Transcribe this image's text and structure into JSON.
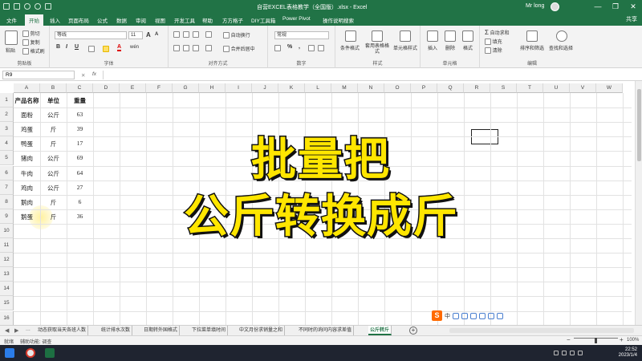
{
  "window": {
    "title": "自营EXCEL表格教学（全国版）.xlsx - Excel",
    "user": "Mr long",
    "minimize_label": "—",
    "restore_label": "❐",
    "close_label": "✕"
  },
  "tabs": [
    {
      "label": "文件"
    },
    {
      "label": "开始"
    },
    {
      "label": "插入"
    },
    {
      "label": "页面布局"
    },
    {
      "label": "公式"
    },
    {
      "label": "数据"
    },
    {
      "label": "审阅"
    },
    {
      "label": "视图"
    },
    {
      "label": "开发工具"
    },
    {
      "label": "帮助"
    },
    {
      "label": "方方格子"
    },
    {
      "label": "DIY工具箱"
    },
    {
      "label": "Power Pivot"
    },
    {
      "label": "操作说明搜索"
    }
  ],
  "share_label": "共享",
  "ribbon": {
    "clipboard": {
      "paste": "粘贴",
      "cut": "剪切",
      "copy": "复制",
      "format_painter": "格式刷",
      "group": "剪贴板"
    },
    "font": {
      "name": "等线",
      "size": "11",
      "bold": "B",
      "italic": "I",
      "underline": "U",
      "grow": "A",
      "shrink": "A",
      "font_color": "A",
      "wen": "wén",
      "group": "字体"
    },
    "alignment": {
      "wrap": "自动换行",
      "merge": "合并后居中",
      "group": "对齐方式"
    },
    "number": {
      "format": "常规",
      "currency": "%",
      "comma": ",",
      "group": "数字"
    },
    "styles": {
      "conditional": "条件格式",
      "table": "套用表格格式",
      "cell": "单元格样式",
      "group": "样式"
    },
    "cells": {
      "insert": "插入",
      "delete": "删除",
      "format": "格式",
      "group": "单元格"
    },
    "editing": {
      "autosum": "自动求和",
      "fill": "填充",
      "clear": "清除",
      "sort": "排序和筛选",
      "find": "查找和选择",
      "group": "编辑"
    }
  },
  "formula_bar": {
    "name_box": "R9",
    "fx": "fx",
    "cancel": "✕",
    "enter": "✓",
    "value": ""
  },
  "columns": [
    "A",
    "B",
    "C",
    "D",
    "E",
    "F",
    "G",
    "H",
    "I",
    "J",
    "K",
    "L",
    "M",
    "N",
    "O",
    "P",
    "Q",
    "R",
    "S",
    "T",
    "U",
    "V",
    "W"
  ],
  "rows": [
    "1",
    "2",
    "3",
    "4",
    "5",
    "6",
    "7",
    "8",
    "9",
    "10",
    "11",
    "12",
    "13",
    "14",
    "15",
    "16"
  ],
  "table": {
    "headers": [
      "产品名称",
      "单位",
      "重量"
    ],
    "rows": [
      [
        "面粉",
        "公斤",
        "63"
      ],
      [
        "鸡蛋",
        "斤",
        "39"
      ],
      [
        "鸭蛋",
        "斤",
        "17"
      ],
      [
        "猪肉",
        "公斤",
        "69"
      ],
      [
        "牛肉",
        "公斤",
        "64"
      ],
      [
        "鸡肉",
        "公斤",
        "27"
      ],
      [
        "鹅肉",
        "斤",
        "6"
      ],
      [
        "鹅蛋",
        "斤",
        "36"
      ]
    ]
  },
  "overlay": {
    "line1": "批量把",
    "line2": "公斤转换成斤"
  },
  "sheet_tabs": [
    "动态获取当天各班人数",
    "统计排水次数",
    "日期转外国格式",
    "下拉菜单填时间",
    "中文月份求销量之和",
    "不同时的询问内容求差值",
    "公斤转斤"
  ],
  "sheet_nav": {
    "prev": "◀",
    "next": "▶",
    "more": "..."
  },
  "add_sheet": "+",
  "ime": {
    "logo": "S",
    "lang": "中"
  },
  "status": {
    "ready": "就绪",
    "accessibility": "辅助功能: 调查",
    "zoom": "100%",
    "zoom_minus": "−",
    "zoom_plus": "+"
  },
  "taskbar": {
    "time": "22:52",
    "date": "2023/1/4"
  },
  "colors": {
    "excel_green": "#217346",
    "overlay_text": "#ffe600",
    "overlay_stroke": "#111111"
  }
}
